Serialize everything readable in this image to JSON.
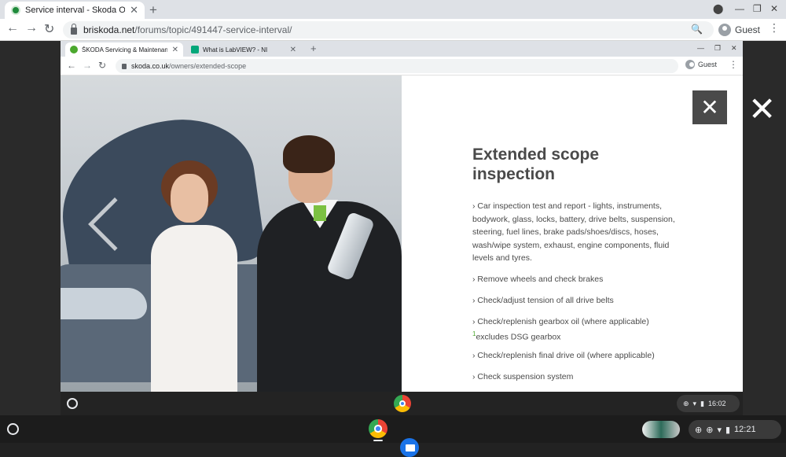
{
  "outer_browser": {
    "tab_title": "Service interval - Skoda Octavia",
    "url_host": "briskoda.net",
    "url_path": "/forums/topic/491447-service-interval/",
    "guest_label": "Guest"
  },
  "inner_browser": {
    "tabs": [
      {
        "title": "ŠKODA Servicing & Maintenance"
      },
      {
        "title": "What is LabVIEW? - NI"
      }
    ],
    "url_host": "skoda.co.uk",
    "url_path": "/owners/extended-scope",
    "guest_label": "Guest"
  },
  "page": {
    "heading": "Extended scope inspection",
    "items": [
      "› Car inspection test and report - lights, instruments, bodywork, glass, locks, battery, drive belts, suspension, steering, fuel lines, brake pads/shoes/discs, hoses, wash/wipe system, exhaust, engine components, fluid levels and tyres.",
      "› Remove wheels and check brakes",
      "› Check/adjust tension of all drive belts",
      "› Check/replenish gearbox oil (where applicable)",
      "› Check/replenish final drive oil (where applicable)",
      "› Check suspension system"
    ],
    "footnote_mark": "1",
    "footnote_text": "excludes DSG gearbox"
  },
  "inner_shelf": {
    "time": "16:02"
  },
  "os_shelf": {
    "time": "12:21"
  },
  "colors": {
    "accent_green": "#4ba82e",
    "heading_gray": "#4a4a4a"
  }
}
